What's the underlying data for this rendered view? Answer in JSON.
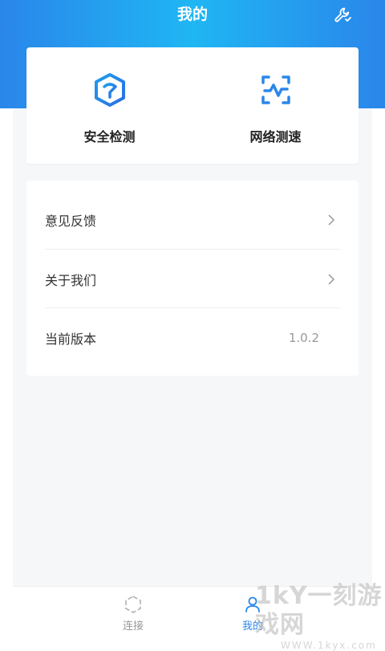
{
  "header": {
    "title": "我的",
    "settings_icon": "wrench-settings-icon",
    "gradient_colors": [
      "#2a86ea",
      "#1fb6f3"
    ]
  },
  "tools": [
    {
      "label": "安全检测",
      "icon": "security-shield-icon"
    },
    {
      "label": "网络测速",
      "icon": "network-speed-icon"
    }
  ],
  "menu": {
    "feedback": "意见反馈",
    "about": "关于我们",
    "version_label": "当前版本",
    "version_value": "1.0.2"
  },
  "tabbar": {
    "tabs": [
      {
        "label": "连接",
        "icon": "hexagon-icon",
        "active": false
      },
      {
        "label": "我的",
        "icon": "user-icon",
        "active": true
      }
    ],
    "active_color": "#2a86ea",
    "inactive_color": "#999999"
  },
  "watermark": {
    "brand": "1kY一刻游戏网",
    "url": "WWW.1kyx.com"
  }
}
